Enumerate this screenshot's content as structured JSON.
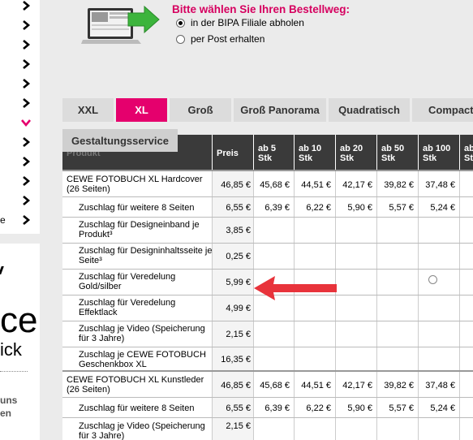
{
  "sidebar": {
    "right_fragments": [
      "e"
    ],
    "box_fragments": [
      "ce",
      "ick",
      "uns",
      "en"
    ]
  },
  "order": {
    "title": "Bitte wählen Sie Ihren Bestellweg:",
    "options": [
      {
        "label": "in der BIPA Filiale abholen",
        "selected": true
      },
      {
        "label": "per Post erhalten",
        "selected": false
      }
    ]
  },
  "tabs": [
    "XXL",
    "XL",
    "Groß",
    "Groß Panorama",
    "Quadratisch",
    "Compact"
  ],
  "active_tab": "XL",
  "service_tab": "Gestaltungsservice",
  "table": {
    "header_first": "Produkt",
    "price_header": "Preis",
    "qty_headers": [
      [
        "ab 5",
        "Stk"
      ],
      [
        "ab 10",
        "Stk"
      ],
      [
        "ab 20",
        "Stk"
      ],
      [
        "ab 50",
        "Stk"
      ],
      [
        "ab 100",
        "Stk"
      ],
      [
        "ab",
        "Stk"
      ]
    ],
    "rows": [
      {
        "name": "CEWE FOTOBUCH XL Hardcover (26 Seiten)",
        "sub": false,
        "price": "46,85 €",
        "vals": [
          "45,68 €",
          "44,51 €",
          "42,17 €",
          "39,82 €",
          "37,48 €"
        ]
      },
      {
        "name": "Zuschlag für weitere 8 Seiten",
        "sub": true,
        "price": "6,55 €",
        "vals": [
          "6,39 €",
          "6,22 €",
          "5,90 €",
          "5,57 €",
          "5,24 €"
        ]
      },
      {
        "name": "Zuschlag für Designeinband je Produkt³",
        "sub": true,
        "price": "3,85 €",
        "vals": []
      },
      {
        "name": "Zuschlag für Designinhaltsseite je Seite³",
        "sub": true,
        "price": "0,25 €",
        "vals": []
      },
      {
        "name": "Zuschlag für Veredelung Gold/silber",
        "sub": true,
        "price": "5,99 €",
        "vals": []
      },
      {
        "name": "Zuschlag für Veredelung Effektlack",
        "sub": true,
        "price": "4,99 €",
        "vals": []
      },
      {
        "name": "Zuschlag je Video (Speicherung für 3 Jahre)",
        "sub": true,
        "price": "2,15 €",
        "vals": []
      },
      {
        "name": "Zuschlag je CEWE FOTOBUCH Geschenkbox XL",
        "sub": true,
        "price": "16,35 €",
        "vals": []
      },
      {
        "name": "CEWE FOTOBUCH XL Kunstleder (26 Seiten)",
        "sub": false,
        "price": "46,85 €",
        "vals": [
          "45,68 €",
          "44,51 €",
          "42,17 €",
          "39,82 €",
          "37,48 €"
        ]
      },
      {
        "name": "Zuschlag für weitere 8 Seiten",
        "sub": true,
        "price": "6,55 €",
        "vals": [
          "6,39 €",
          "6,22 €",
          "5,90 €",
          "5,57 €",
          "5,24 €"
        ]
      },
      {
        "name": "Zuschlag je Video (Speicherung für 3 Jahre)",
        "sub": true,
        "price": "2,15 €",
        "vals": []
      }
    ]
  },
  "colors": {
    "accent": "#e5006d",
    "header_bg": "#3a3a3a",
    "arrow": "#e8333b",
    "cta_arrow": "#3cb43c"
  }
}
